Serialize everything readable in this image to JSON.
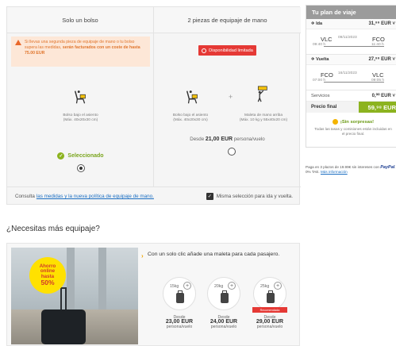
{
  "baggage": {
    "left": {
      "title": "Solo un bolso",
      "warning_prefix": "Si llevas una segunda pieza de equipaje de mano o tu bolso supera las medidas, ",
      "warning_bold": "serán facturados con un coste de hasta 75.00 EUR",
      "caption_line1": "Bolso bajo el asiento",
      "caption_line2": "(Máx. 40x20x30 cm)",
      "selected_label": "Seleccionado",
      "selected": true
    },
    "right": {
      "title": "2 piezas de equipaje de mano",
      "badge": "Disponibilidad limitada",
      "caption1_line1": "Bolso bajo el asiento",
      "caption1_line2": "(Máx. 40x20x30 cm)",
      "plus": "+",
      "caption2_line1": "Maleta de mano arriba",
      "caption2_line2": "(Máx. 10 kg y 55x40x20 cm)",
      "price_prefix": "Desde",
      "price": "21,00 EUR",
      "price_suffix": "persona/vuelo",
      "selected": false
    },
    "footer": {
      "prefix": "Consulta",
      "link": "las medidas y la nueva política de equipaje de mano.",
      "same_selection": "Misma selección para ida y vuelta.",
      "same_checked": true
    }
  },
  "trip_plan": {
    "title": "Tu plan de viaje",
    "outbound": {
      "label": "Ida",
      "amount": "31,⁹⁹ EUR",
      "from": "VLC",
      "from_time": "09:40 h",
      "date": "09/11/2023",
      "to": "FCO",
      "to_time": "11:40 h"
    },
    "return": {
      "label": "Vuelta",
      "amount": "27,⁹⁹ EUR",
      "from": "FCO",
      "from_time": "07:00 h",
      "date": "16/11/2023",
      "to": "VLC",
      "to_time": "09:05 h"
    },
    "services_label": "Servicios",
    "services_amount": "0,⁰⁰ EUR",
    "final_label": "Precio final",
    "final_amount": "59,⁹⁸ EUR",
    "no_surprises": "¡Sin sorpresas!",
    "no_surprises_text": "Todas las tasas y comisiones están incluidas en el precio final."
  },
  "paypal": {
    "text": "Paga en 3 plazos de 19.99€ sin intereses con",
    "brand": "PayPal",
    "tae": ". 0% TAE.",
    "link": "Más información"
  },
  "more_luggage": {
    "title": "¿Necesitas más equipaje?",
    "promo_line1": "Ahorro",
    "promo_line2": "online",
    "promo_line3": "hasta",
    "promo_pct": "50%",
    "offer_text": "Con un solo clic añade una maleta para cada pasajero.",
    "options": [
      {
        "weight": "15kg",
        "from": "Desde",
        "price": "23,00 EUR",
        "unit": "persona/vuelo"
      },
      {
        "weight": "20kg",
        "from": "Desde",
        "price": "24,00 EUR",
        "unit": "persona/vuelo"
      },
      {
        "weight": "25kg",
        "from": "Desde",
        "price": "29,00 EUR",
        "unit": "persona/vuelo",
        "badge": "Recomendada"
      }
    ]
  },
  "colors": {
    "accent_green": "#8cb31f",
    "alert_red": "#e53935",
    "warning_orange": "#e9682a",
    "promo_yellow": "#ffe100"
  }
}
